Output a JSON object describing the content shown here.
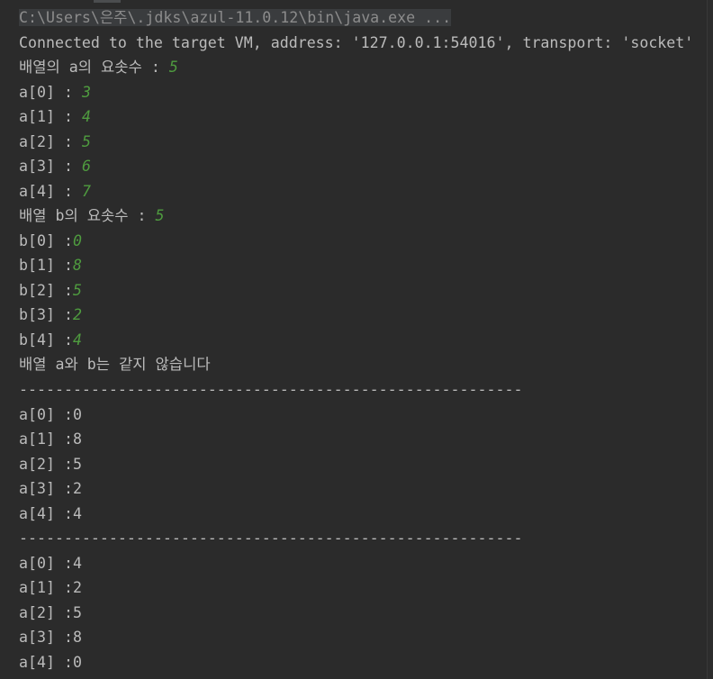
{
  "colors": {
    "background": "#2b2b2b",
    "text": "#bbbbbb",
    "user_input": "#4f9c3f",
    "command_text": "#8c8c8c",
    "command_background": "#3a3c3e"
  },
  "console": {
    "command_line": "C:\\Users\\은주\\.jdks\\azul-11.0.12\\bin\\java.exe ...",
    "lines": [
      {
        "text": "Connected to the target VM, address: '127.0.0.1:54016', transport: 'socket'"
      },
      {
        "text": "배열의 a의 요솟수 : ",
        "input": "5"
      },
      {
        "text": "a[0] : ",
        "input": "3"
      },
      {
        "text": "a[1] : ",
        "input": "4"
      },
      {
        "text": "a[2] : ",
        "input": "5"
      },
      {
        "text": "a[3] : ",
        "input": "6"
      },
      {
        "text": "a[4] : ",
        "input": "7"
      },
      {
        "text": "배열 b의 요솟수 : ",
        "input": "5"
      },
      {
        "text": "b[0] :",
        "input": "0"
      },
      {
        "text": "b[1] :",
        "input": "8"
      },
      {
        "text": "b[2] :",
        "input": "5"
      },
      {
        "text": "b[3] :",
        "input": "2"
      },
      {
        "text": "b[4] :",
        "input": "4"
      },
      {
        "text": "배열 a와 b는 같지 않습니다"
      },
      {
        "text": "--------------------------------------------------------"
      },
      {
        "text": "a[0] :0"
      },
      {
        "text": "a[1] :8"
      },
      {
        "text": "a[2] :5"
      },
      {
        "text": "a[3] :2"
      },
      {
        "text": "a[4] :4"
      },
      {
        "text": "--------------------------------------------------------"
      },
      {
        "text": "a[0] :4"
      },
      {
        "text": "a[1] :2"
      },
      {
        "text": "a[2] :5"
      },
      {
        "text": "a[3] :8"
      },
      {
        "text": "a[4] :0"
      }
    ]
  }
}
